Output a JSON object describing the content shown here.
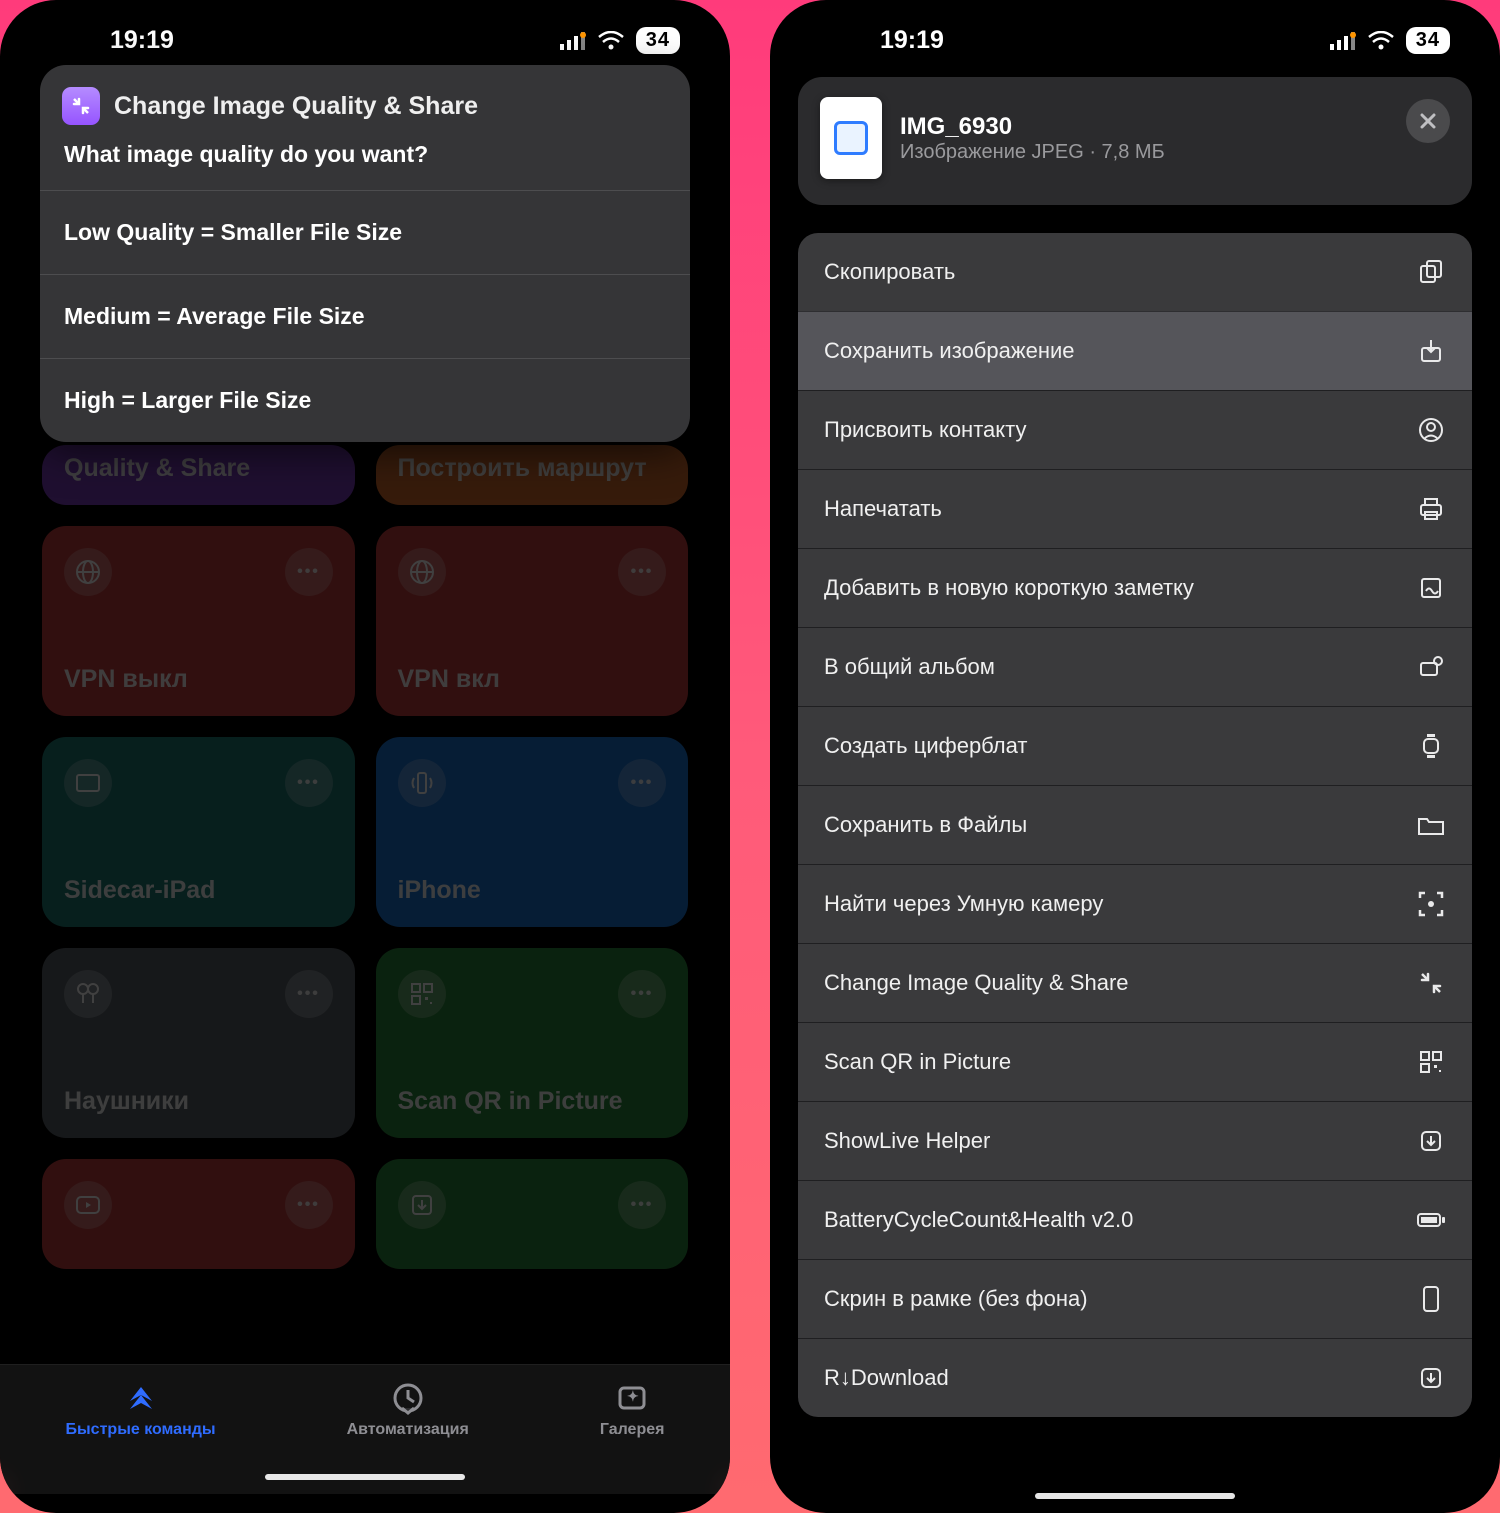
{
  "status": {
    "time": "19:19",
    "battery": "34"
  },
  "left": {
    "sheet": {
      "title": "Change Image Quality & Share",
      "prompt": "What image quality do you want?",
      "options": [
        "Low Quality = Smaller File Size",
        "Medium = Average File Size",
        "High = Larger File Size"
      ]
    },
    "tiles": [
      {
        "label": "Quality & Share"
      },
      {
        "label": "Построить маршрут"
      },
      {
        "label": "VPN выкл"
      },
      {
        "label": "VPN вкл"
      },
      {
        "label": "Sidecar-iPad"
      },
      {
        "label": "iPhone"
      },
      {
        "label": "Наушники"
      },
      {
        "label": "Scan QR in Picture"
      }
    ],
    "tabs": {
      "shortcuts": "Быстрые команды",
      "automation": "Автоматизация",
      "gallery": "Галерея"
    }
  },
  "right": {
    "file": {
      "name": "IMG_6930",
      "subtitle": "Изображение JPEG · 7,8 МБ"
    },
    "actions": [
      {
        "label": "Скопировать"
      },
      {
        "label": "Сохранить изображение"
      },
      {
        "label": "Присвоить контакту"
      },
      {
        "label": "Напечатать"
      },
      {
        "label": "Добавить в новую короткую заметку"
      },
      {
        "label": "В общий альбом"
      },
      {
        "label": "Создать циферблат"
      },
      {
        "label": "Сохранить в Файлы"
      },
      {
        "label": "Найти через Умную камеру"
      },
      {
        "label": "Change Image Quality & Share"
      },
      {
        "label": "Scan QR in Picture"
      },
      {
        "label": "ShowLive Helper"
      },
      {
        "label": "BatteryCycleCount&Health v2.0"
      },
      {
        "label": "Скрин в рамке (без фона)"
      },
      {
        "label": "R↓Download"
      }
    ]
  }
}
